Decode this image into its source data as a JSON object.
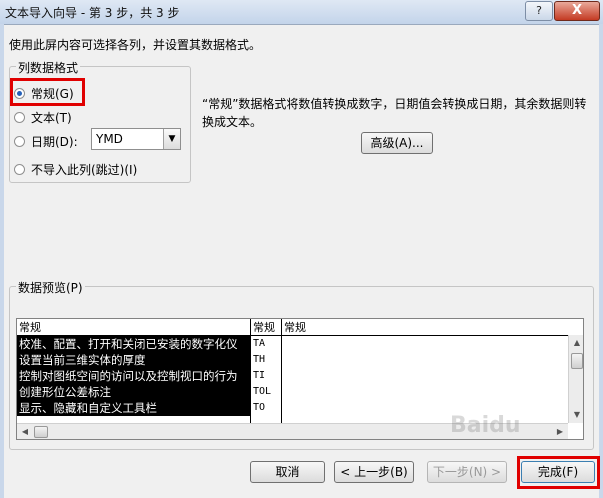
{
  "window": {
    "title": "文本导入向导 - 第 3 步，共 3 步",
    "help_label": "?",
    "close_label": "X"
  },
  "instruction": "使用此屏内容可选择各列，并设置其数据格式。",
  "column_format": {
    "legend": "列数据格式",
    "options": [
      {
        "label": "常规(G)",
        "checked": true
      },
      {
        "label": "文本(T)",
        "checked": false
      },
      {
        "label": "日期(D):",
        "checked": false
      },
      {
        "label": "不导入此列(跳过)(I)",
        "checked": false
      }
    ],
    "date_format_value": "YMD",
    "highlight_color": "#e00000"
  },
  "description": "“常规”数据格式将数值转换成数字，日期值会转换成日期，其余数据则转换成文本。",
  "advanced_button": "高级(A)...",
  "preview": {
    "legend": "数据预览(P)",
    "headers": [
      "常规",
      "常规",
      "常规"
    ],
    "rows": [
      {
        "desc": "校准、配置、打开和关闭已安装的数字化仪",
        "code": "TA"
      },
      {
        "desc": "设置当前三维实体的厚度",
        "code": "TH"
      },
      {
        "desc": "控制对图纸空间的访问以及控制视口的行为",
        "code": "TI"
      },
      {
        "desc": "创建形位公差标注",
        "code": "TOL"
      },
      {
        "desc": "显示、隐藏和自定义工具栏",
        "code": "TO"
      }
    ]
  },
  "buttons": {
    "cancel": "取消",
    "back": "< 上一步(B)",
    "next": "下一步(N) >",
    "finish": "完成(F)"
  },
  "watermark": "Baidu"
}
